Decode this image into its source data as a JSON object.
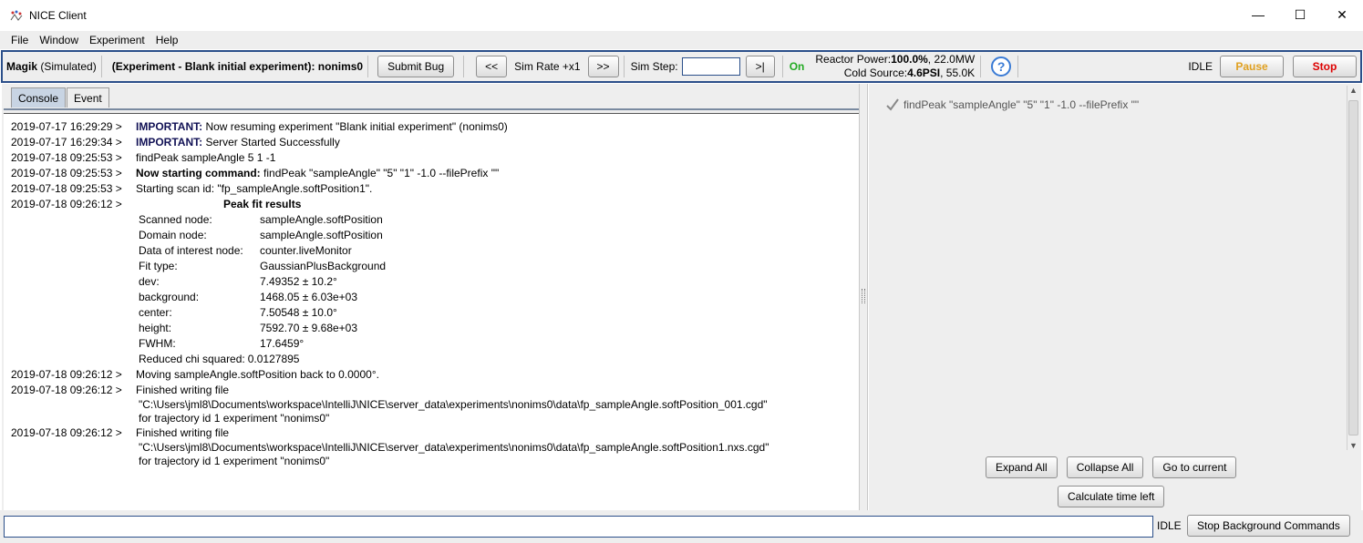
{
  "window": {
    "title": "NICE Client",
    "controls": {
      "minimize": "—",
      "maximize": "☐",
      "close": "✕"
    }
  },
  "menu": [
    "File",
    "Window",
    "Experiment",
    "Help"
  ],
  "toolbar": {
    "instrument_name": "Magik",
    "instrument_mode": "(Simulated)",
    "experiment": "(Experiment - Blank initial experiment): nonims0",
    "submit_bug": "Submit Bug",
    "rewind": "<<",
    "sim_rate": "Sim Rate +x1",
    "forward": ">>",
    "sim_step_label": "Sim Step:",
    "sim_step_value": "",
    "step_button": ">|",
    "on_status": "On",
    "reactor_power_label": "Reactor Power:",
    "reactor_power_value": "100.0%",
    "reactor_power_mw": ", 22.0MW",
    "cold_source_label": "Cold Source:",
    "cold_source_value": "4.6PSI",
    "cold_source_k": ", 55.0K",
    "help": "?",
    "status": "IDLE",
    "pause": "Pause",
    "stop": "Stop"
  },
  "colors": {
    "accent_border": "#2b4f8a",
    "on_green": "#22aa22",
    "pause_orange": "#e0a020",
    "stop_red": "#dd0000"
  },
  "tabs": [
    "Console",
    "Event"
  ],
  "console": {
    "lines": [
      {
        "ts": "2019-07-17 16:29:29 >",
        "kw": "IMPORTANT:",
        "text": " Now resuming experiment \"Blank initial experiment\" (nonims0)"
      },
      {
        "ts": "2019-07-17 16:29:34 >",
        "kw": "IMPORTANT:",
        "text": " Server Started Successfully"
      },
      {
        "ts": "2019-07-18 09:25:53 >",
        "text": "findPeak sampleAngle 5 1 -1"
      },
      {
        "ts": "2019-07-18 09:25:53 >",
        "kwb": "Now starting command:",
        "text": " findPeak \"sampleAngle\" \"5\" \"1\" -1.0 --filePrefix \"\""
      },
      {
        "ts": "2019-07-18 09:25:53 >",
        "text": "Starting scan id: \"fp_sampleAngle.softPosition1\"."
      }
    ],
    "fit_ts": "2019-07-18 09:26:12 >",
    "fit_title": "Peak fit results",
    "fit_rows": [
      {
        "k": "Scanned node:",
        "v": "sampleAngle.softPosition"
      },
      {
        "k": "Domain node:",
        "v": "sampleAngle.softPosition"
      },
      {
        "k": "Data of interest node:",
        "v": "counter.liveMonitor"
      },
      {
        "k": "Fit type:",
        "v": "GaussianPlusBackground"
      },
      {
        "k": "dev:",
        "v": "7.49352 ± 10.2°"
      },
      {
        "k": "background:",
        "v": "1468.05 ± 6.03e+03"
      },
      {
        "k": "center:",
        "v": "7.50548 ± 10.0°"
      },
      {
        "k": "height:",
        "v": "7592.70 ± 9.68e+03"
      },
      {
        "k": "FWHM:",
        "v": "17.6459°"
      }
    ],
    "chi_label": "Reduced chi squared:",
    "chi_value": "0.0127895",
    "moving": {
      "ts": "2019-07-18 09:26:12 >",
      "text": "Moving sampleAngle.softPosition back to 0.0000°."
    },
    "write1": {
      "ts": "2019-07-18 09:26:12 >",
      "text": "Finished writing file",
      "path": "\"C:\\Users\\jml8\\Documents\\workspace\\IntelliJ\\NICE\\server_data\\experiments\\nonims0\\data\\fp_sampleAngle.softPosition_001.cgd\"",
      "traj": "for trajectory id 1 experiment \"nonims0\""
    },
    "write2": {
      "ts": "2019-07-18 09:26:12 >",
      "text": "Finished writing file",
      "path": "\"C:\\Users\\jml8\\Documents\\workspace\\IntelliJ\\NICE\\server_data\\experiments\\nonims0\\data\\fp_sampleAngle.softPosition1.nxs.cgd\"",
      "traj": "for trajectory id 1 experiment \"nonims0\""
    }
  },
  "queue": {
    "item": "findPeak \"sampleAngle\" \"5\" \"1\" -1.0 --filePrefix \"\"",
    "expand_all": "Expand All",
    "collapse_all": "Collapse All",
    "go_to_current": "Go to current",
    "calc_time": "Calculate time left"
  },
  "bottom": {
    "command_value": "",
    "status": "IDLE",
    "stop_bg": "Stop Background Commands"
  }
}
